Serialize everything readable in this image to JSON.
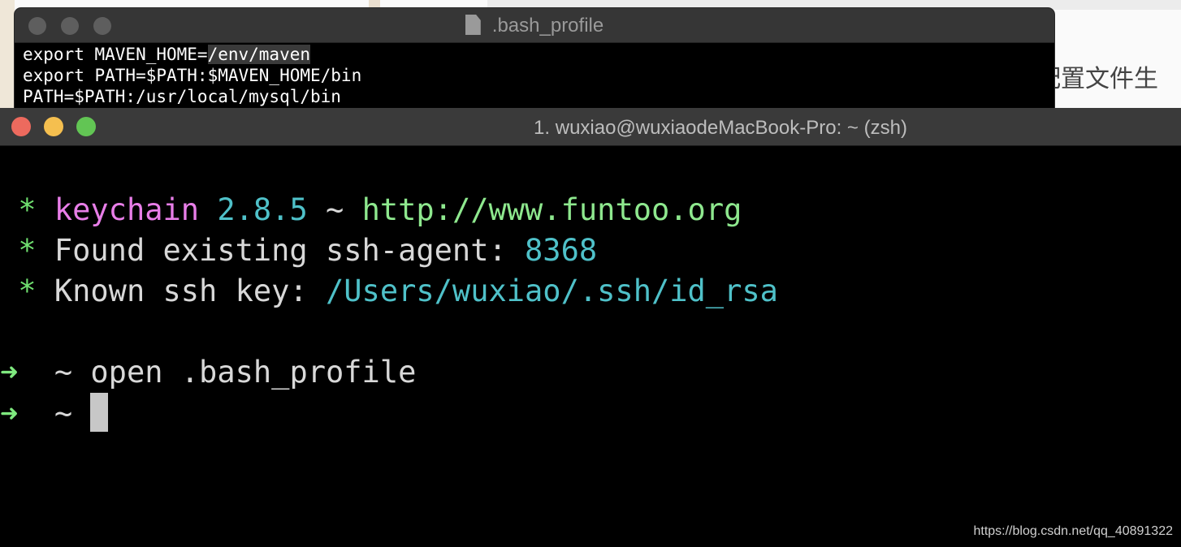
{
  "background": {
    "partial_text": "配置文件生"
  },
  "editor": {
    "title": ".bash_profile",
    "lines": [
      {
        "plain": "export MAVEN_HOME=",
        "selected": "/env/maven"
      },
      {
        "plain": "export PATH=$PATH:$MAVEN_HOME/bin",
        "selected": ""
      },
      {
        "plain": "PATH=$PATH:/usr/local/mysql/bin",
        "selected": ""
      }
    ]
  },
  "terminal": {
    "title": "1. wuxiao@wuxiaodeMacBook-Pro: ~ (zsh)",
    "line1": {
      "star": "*",
      "name": "keychain",
      "version": "2.8.5",
      "sep": "~",
      "url": "http://www.funtoo.org"
    },
    "line2": {
      "star": "*",
      "text": "Found existing ssh-agent:",
      "pid": "8368"
    },
    "line3": {
      "star": "*",
      "text": "Known ssh key:",
      "path": "/Users/wuxiao/.ssh/id_rsa"
    },
    "prompt1": {
      "arrow": "➜",
      "dir": "~",
      "command": "open .bash_profile"
    },
    "prompt2": {
      "arrow": "➜",
      "dir": "~"
    }
  },
  "watermark": "https://blog.csdn.net/qq_40891322",
  "colors": {
    "terminal_bg": "#000000",
    "titlebar": "#3a3a3a",
    "close": "#ed6a5e",
    "minimize": "#f5bf4f",
    "maximize": "#62c554",
    "green": "#6fdf6f",
    "magenta": "#e87ee8",
    "cyan": "#4fc1c9"
  }
}
